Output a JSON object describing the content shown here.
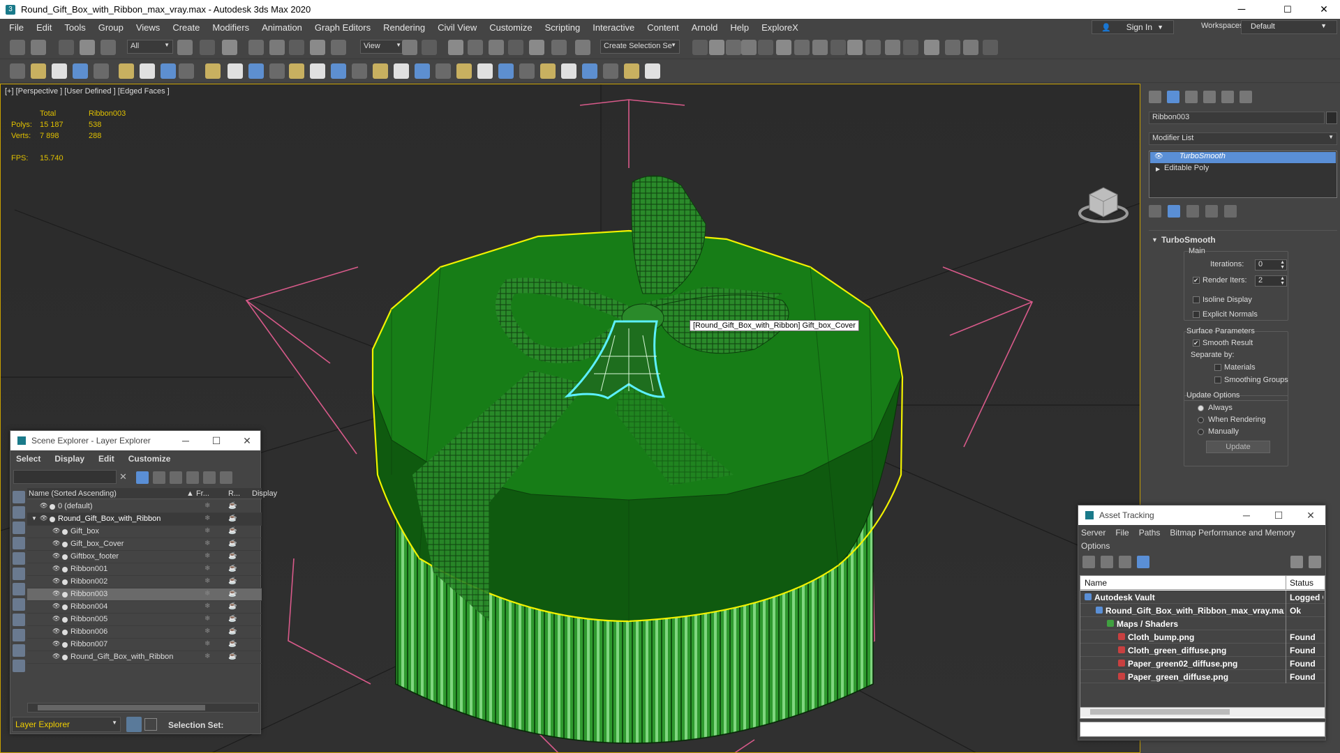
{
  "window": {
    "title": "Round_Gift_Box_with_Ribbon_max_vray.max - Autodesk 3ds Max 2020",
    "min": "─",
    "max": "☐",
    "close": "✕"
  },
  "menu": [
    "File",
    "Edit",
    "Tools",
    "Group",
    "Views",
    "Create",
    "Modifiers",
    "Animation",
    "Graph Editors",
    "Rendering",
    "Civil View",
    "Customize",
    "Scripting",
    "Interactive",
    "Content",
    "Arnold",
    "Help",
    "ExploreX"
  ],
  "signin": {
    "label": "Sign In"
  },
  "workspaces": {
    "label": "Workspaces:",
    "value": "Default"
  },
  "toolbar1": {
    "filter": "All",
    "refcoord": "View",
    "selection_set": "Create Selection Se"
  },
  "viewport": {
    "label": "[+] [Perspective ] [User Defined ] [Edged Faces ]",
    "stats": {
      "total": "Total",
      "object": "Ribbon003",
      "polys_label": "Polys:",
      "polys_total": "15 187",
      "polys_obj": "538",
      "verts_label": "Verts:",
      "verts_total": "7 898",
      "verts_obj": "288",
      "fps_label": "FPS:",
      "fps": "15.740"
    },
    "tooltip": "[Round_Gift_Box_with_Ribbon] Gift_box_Cover"
  },
  "command_panel": {
    "object_name": "Ribbon003",
    "modifier_list": "Modifier List",
    "stack": [
      "TurboSmooth",
      "Editable Poly"
    ],
    "rollout_title": "TurboSmooth",
    "main_label": "Main",
    "iterations_label": "Iterations:",
    "iterations": "0",
    "render_iters_label": "Render Iters:",
    "render_iters": "2",
    "isoline": "Isoline Display",
    "explicit": "Explicit Normals",
    "surface_params": "Surface Parameters",
    "smooth_result": "Smooth Result",
    "separate_by": "Separate by:",
    "materials": "Materials",
    "smoothing_groups": "Smoothing Groups",
    "update_options": "Update Options",
    "always": "Always",
    "when_rendering": "When Rendering",
    "manually": "Manually",
    "update_btn": "Update"
  },
  "scene_explorer": {
    "title": "Scene Explorer - Layer Explorer",
    "menu": [
      "Select",
      "Display",
      "Edit",
      "Customize"
    ],
    "col_name": "Name (Sorted Ascending)",
    "col_fr": "▲ Fr...",
    "col_r": "R...",
    "col_display": "Display",
    "rows": [
      {
        "name": "0 (default)",
        "indent": 0
      },
      {
        "name": "Round_Gift_Box_with_Ribbon",
        "indent": 0
      },
      {
        "name": "Gift_box",
        "indent": 1
      },
      {
        "name": "Gift_box_Cover",
        "indent": 1
      },
      {
        "name": "Giftbox_footer",
        "indent": 1
      },
      {
        "name": "Ribbon001",
        "indent": 1
      },
      {
        "name": "Ribbon002",
        "indent": 1
      },
      {
        "name": "Ribbon003",
        "indent": 1
      },
      {
        "name": "Ribbon004",
        "indent": 1
      },
      {
        "name": "Ribbon005",
        "indent": 1
      },
      {
        "name": "Ribbon006",
        "indent": 1
      },
      {
        "name": "Ribbon007",
        "indent": 1
      },
      {
        "name": "Round_Gift_Box_with_Ribbon",
        "indent": 1
      }
    ],
    "footer_explorer": "Layer Explorer",
    "selection_set": "Selection Set:"
  },
  "asset_tracking": {
    "title": "Asset Tracking",
    "menu": [
      "Server",
      "File",
      "Paths",
      "Bitmap Performance and Memory",
      "Options"
    ],
    "col_name": "Name",
    "col_status": "Status",
    "rows": [
      {
        "name": "Autodesk Vault",
        "status": "Logged C"
      },
      {
        "name": "Round_Gift_Box_with_Ribbon_max_vray.max",
        "status": "Ok"
      },
      {
        "name": "Maps / Shaders",
        "status": ""
      },
      {
        "name": "Cloth_bump.png",
        "status": "Found"
      },
      {
        "name": "Cloth_green_diffuse.png",
        "status": "Found"
      },
      {
        "name": "Paper_green02_diffuse.png",
        "status": "Found"
      },
      {
        "name": "Paper_green_diffuse.png",
        "status": "Found"
      }
    ]
  },
  "colors": {
    "accent": "#4a90d9",
    "viewport_border": "#c8a000",
    "selection": "#f0f000",
    "gift_green": "#1f7a1f"
  }
}
